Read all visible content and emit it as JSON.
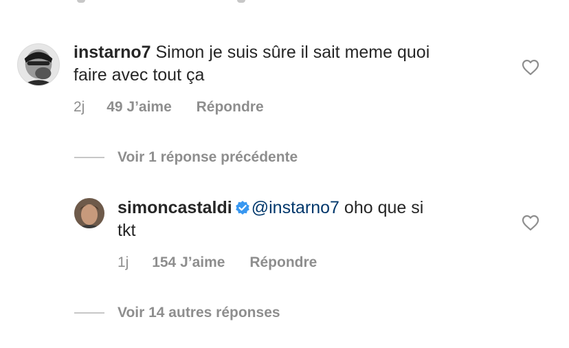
{
  "comments": [
    {
      "username": "instarno7",
      "text": "Simon je suis sûre il sait meme quoi faire avec tout ça",
      "text_line1": " Simon je suis sûre il sait meme quoi",
      "text_line2": "faire avec tout ça",
      "time": "2j",
      "likes": "49 J’aime",
      "reply": "Répondre"
    }
  ],
  "view_previous": "Voir 1 réponse précédente",
  "replies": [
    {
      "username": "simoncastaldi",
      "verified": true,
      "mention": "@instarno7",
      "text_line1": " oho que si",
      "text_line2": "tkt",
      "time": "1j",
      "likes": "154 J’aime",
      "reply": "Répondre"
    }
  ],
  "view_more": "Voir 14 autres réponses",
  "icons": {
    "like": "heart-outline-icon",
    "verified": "verified-badge-icon"
  },
  "colors": {
    "text": "#262626",
    "secondary": "#8e8e8e",
    "mention": "#00376b",
    "verified": "#3897f0",
    "line": "#c7c7c7"
  }
}
